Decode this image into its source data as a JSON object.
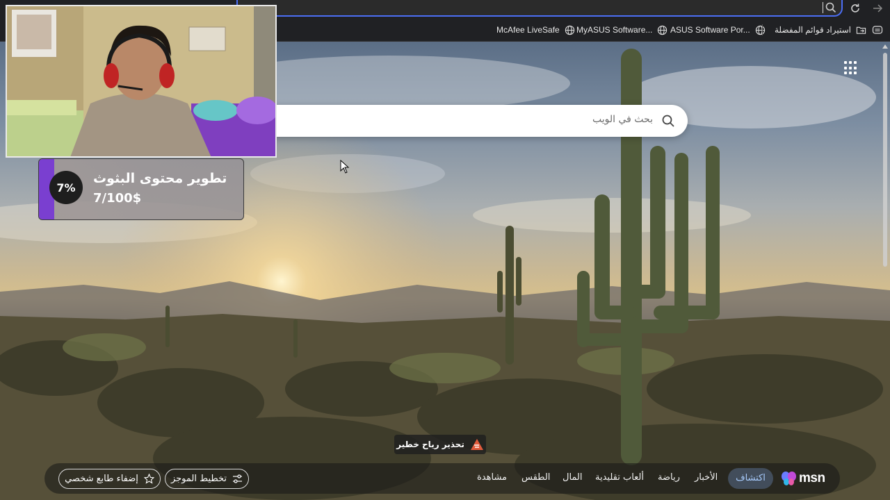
{
  "favorites_bar": {
    "items": [
      {
        "label": "McAfee LiveSafe",
        "icon": "globe-icon"
      },
      {
        "label": "MyASUS Software...",
        "icon": "globe-icon"
      },
      {
        "label": "ASUS Software Por...",
        "icon": "globe-icon"
      },
      {
        "label": "استيراد قوائم المفضلة",
        "icon": "folder-import-icon"
      }
    ]
  },
  "search": {
    "placeholder": "بحث في الويب"
  },
  "alert": {
    "text": "تحذير رياح خطير"
  },
  "bottom_nav": {
    "brand": "msn",
    "active_tab": "اكتشاف",
    "tabs": [
      "الأخبار",
      "رياضة",
      "ألعاب تقليدية",
      "المال",
      "الطقس",
      "مشاهدة"
    ],
    "plan_button": "تخطيط الموجز",
    "personalize_button": "إضفاء طابع شخصي"
  },
  "donation_goal": {
    "percent": "7%",
    "title": "تطوير محتوى البثوث",
    "amount": "7/100$",
    "progress": 0.07
  },
  "colors": {
    "accent": "#7a3fd0",
    "omnibox_border": "#4c6ef5",
    "active_tab_text": "#a9cdff"
  }
}
